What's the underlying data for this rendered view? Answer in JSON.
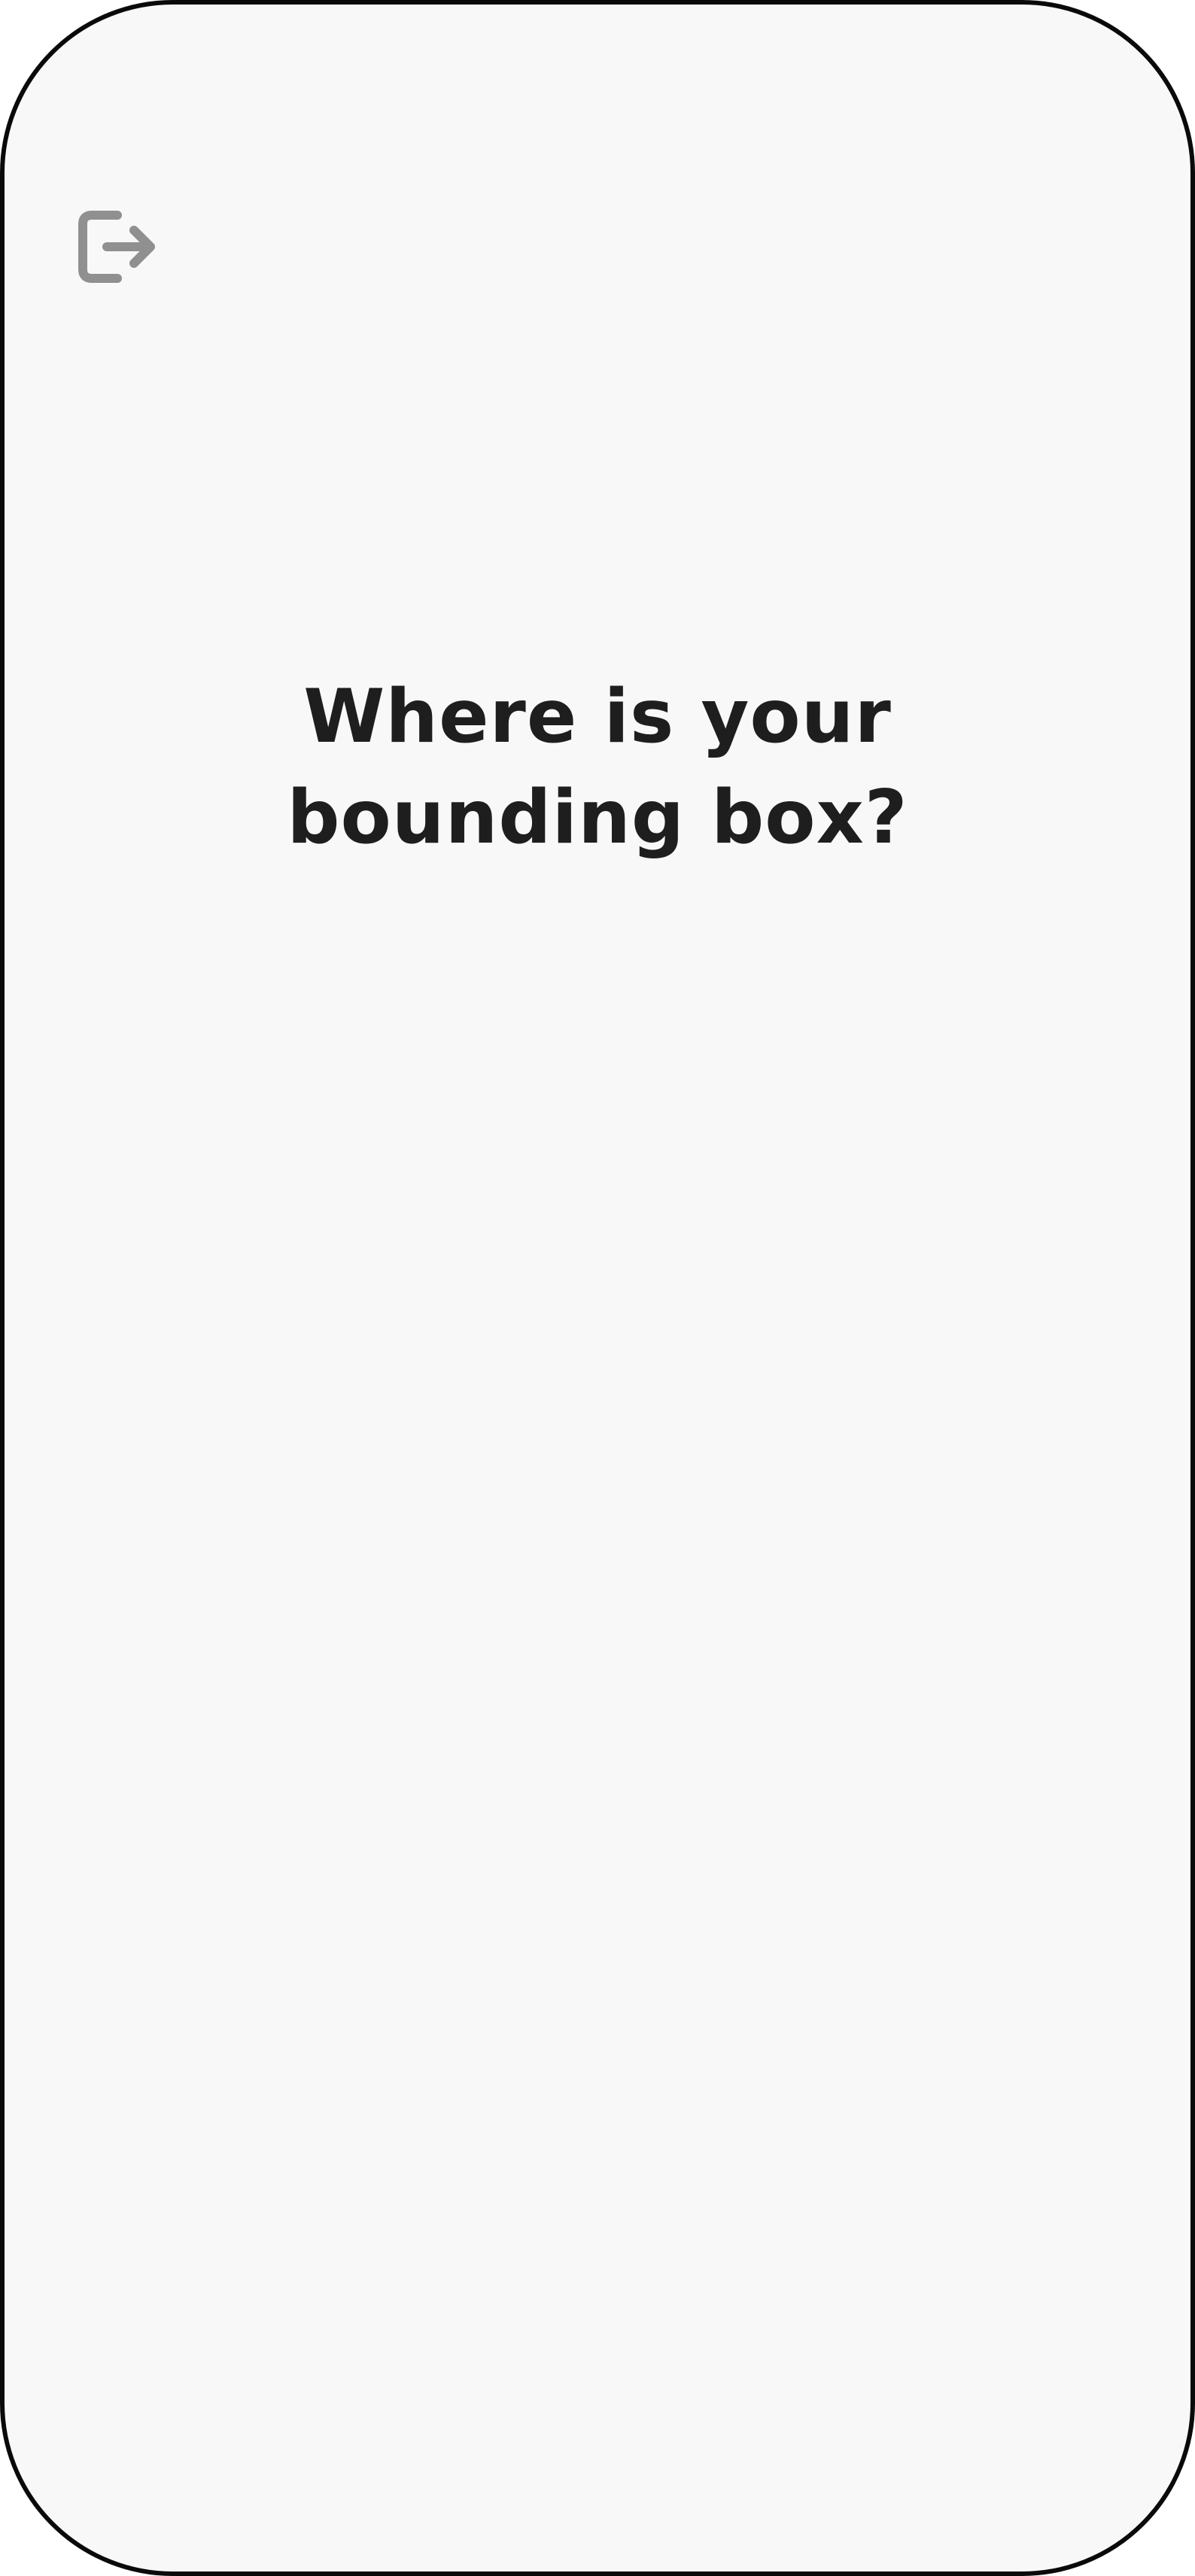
{
  "screen": {
    "background_color": "#f8f8f8",
    "frame_color": "#0a0a0a"
  },
  "exit_button": {
    "icon": "exit-icon",
    "icon_color": "#909090"
  },
  "prompt": {
    "line1": "Where is your",
    "line2": "bounding box?",
    "text_color": "#1e1e1e"
  }
}
